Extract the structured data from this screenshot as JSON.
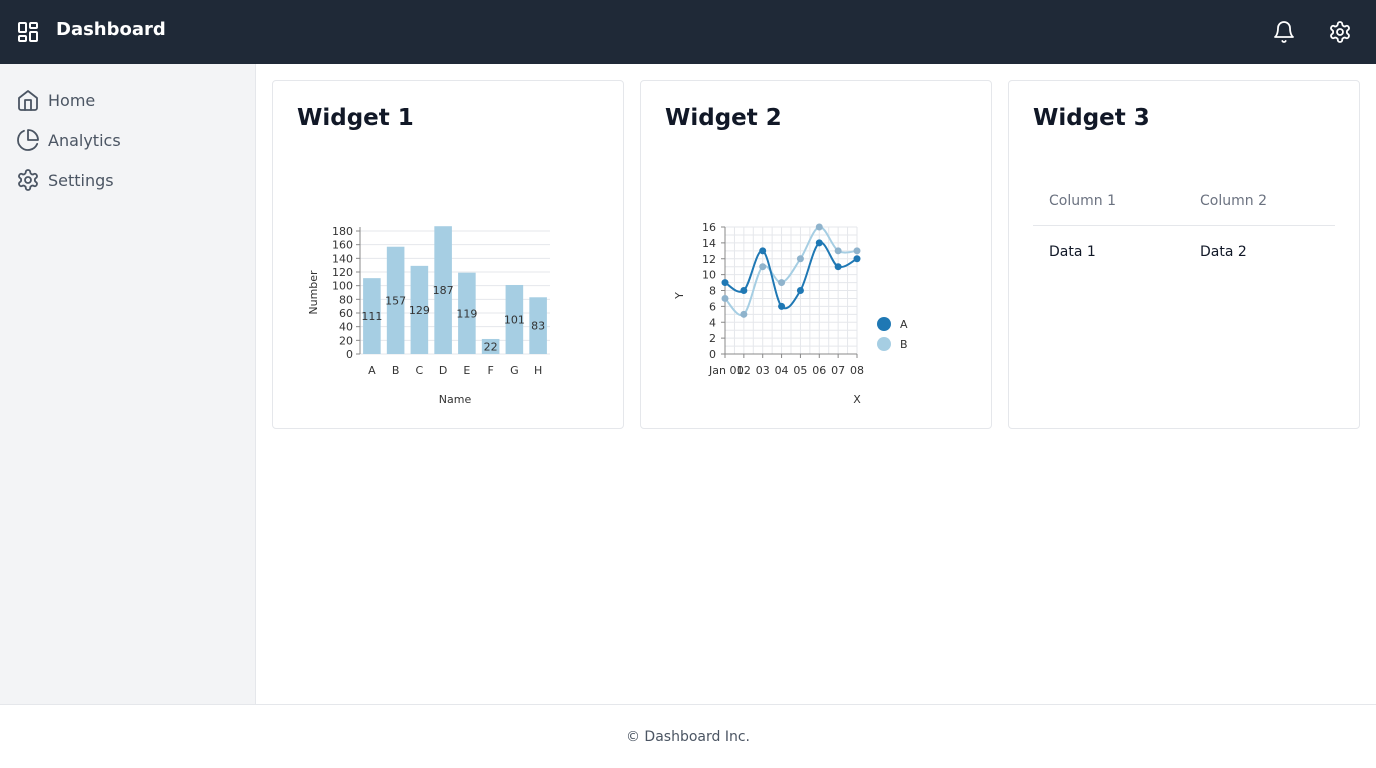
{
  "header": {
    "title": "Dashboard"
  },
  "sidebar": {
    "items": [
      {
        "label": "Home",
        "icon": "home-icon"
      },
      {
        "label": "Analytics",
        "icon": "pie-chart-icon"
      },
      {
        "label": "Settings",
        "icon": "gear-icon"
      }
    ]
  },
  "widgets": [
    {
      "title": "Widget 1"
    },
    {
      "title": "Widget 2"
    },
    {
      "title": "Widget 3"
    }
  ],
  "table": {
    "headers": [
      "Column 1",
      "Column 2"
    ],
    "rows": [
      [
        "Data 1",
        "Data 2"
      ]
    ]
  },
  "footer": {
    "text": "© Dashboard Inc."
  },
  "colors": {
    "topbar": "#1f2937",
    "bar": "#a6cee3",
    "series_a": "#1f78b4",
    "series_b": "#a6cee3"
  },
  "chart_data": [
    {
      "type": "bar",
      "categories": [
        "A",
        "B",
        "C",
        "D",
        "E",
        "F",
        "G",
        "H"
      ],
      "values": [
        111,
        157,
        129,
        187,
        119,
        22,
        101,
        83
      ],
      "xlabel": "Name",
      "ylabel": "Number",
      "ylim": [
        0,
        180
      ],
      "yticks": [
        0,
        20,
        40,
        60,
        80,
        100,
        120,
        140,
        160,
        180
      ],
      "grid": true
    },
    {
      "type": "line",
      "x": [
        "Jan 01",
        "02",
        "03",
        "04",
        "05",
        "06",
        "07",
        "08"
      ],
      "xtick_labels": [
        "Jan 01",
        "02",
        "03",
        "04",
        "05",
        "06",
        "07",
        "08"
      ],
      "series": [
        {
          "name": "A",
          "values": [
            9,
            8,
            13,
            6,
            8,
            14,
            11,
            12
          ]
        },
        {
          "name": "B",
          "values": [
            7,
            5,
            11,
            9,
            12,
            16,
            13,
            13
          ]
        }
      ],
      "xlabel": "X",
      "ylabel": "Y",
      "ylim": [
        0,
        16
      ],
      "yticks": [
        0,
        2,
        4,
        6,
        8,
        10,
        12,
        14,
        16
      ],
      "grid": true,
      "legend": "right"
    }
  ]
}
